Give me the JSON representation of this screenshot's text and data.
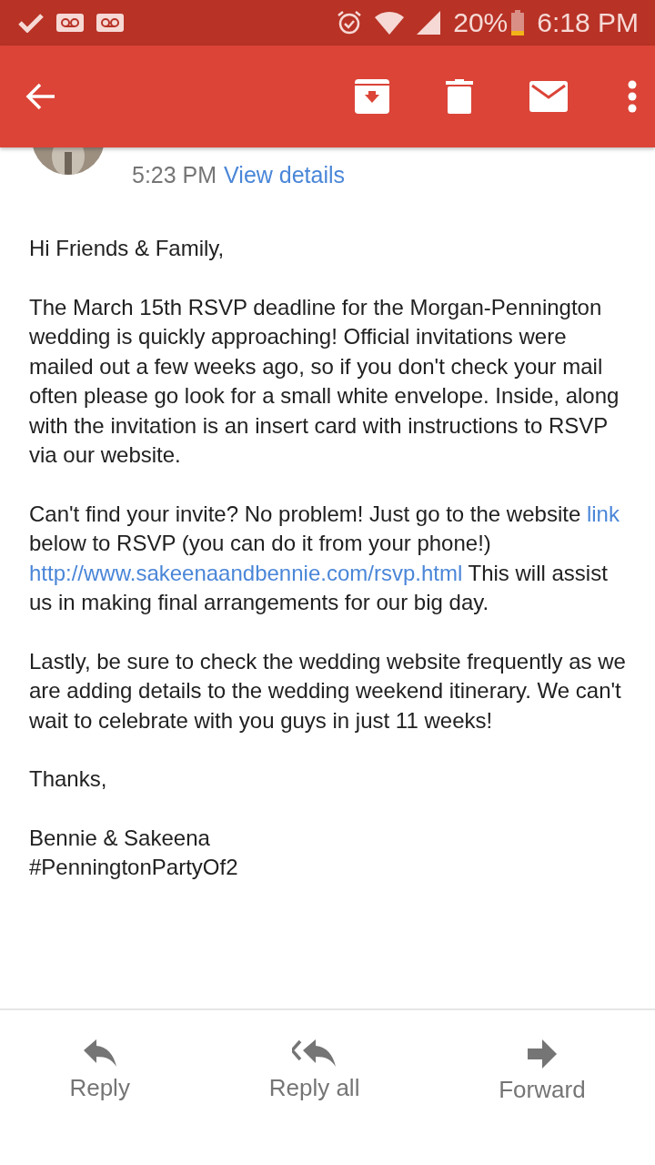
{
  "status_bar": {
    "battery": "20%",
    "time": "6:18 PM"
  },
  "message_header": {
    "time": "5:23 PM",
    "details_link": "View details"
  },
  "body": [
    {
      "kind": "plain",
      "text": "Hi Friends & Family,"
    },
    {
      "kind": "plain",
      "text": "The March 15th RSVP deadline for the Morgan-Pennington wedding is quickly approaching! Official invitations were mailed out a few weeks ago, so if you don't check your mail often please go look for a small white envelope. Inside, along with the invitation is an insert card with instructions to RSVP via our website."
    },
    {
      "kind": "mixed",
      "parts": [
        {
          "kind": "text",
          "text": "Can't find your invite? No problem! Just go to the website "
        },
        {
          "kind": "link",
          "text": "link"
        },
        {
          "kind": "text",
          "text": " below to RSVP (you can do it from your phone!) "
        },
        {
          "kind": "link",
          "text": "http://www.sakeenaandbennie.com/rsvp.html"
        },
        {
          "kind": "text",
          "text": " This will assist us in making final arrangements for our big day."
        }
      ]
    },
    {
      "kind": "plain",
      "text": "Lastly, be sure to check the wedding website frequently as we are adding details to the wedding weekend itinerary. We can't wait to celebrate with you guys in just 11 weeks!"
    },
    {
      "kind": "plain",
      "text": "Thanks,"
    },
    {
      "kind": "lines",
      "lines": [
        "Bennie & Sakeena",
        "#PenningtonPartyOf2"
      ]
    }
  ],
  "actions": [
    {
      "kind": "reply",
      "label": "Reply"
    },
    {
      "kind": "reply_all",
      "label": "Reply all"
    },
    {
      "kind": "forward",
      "label": "Forward"
    }
  ]
}
